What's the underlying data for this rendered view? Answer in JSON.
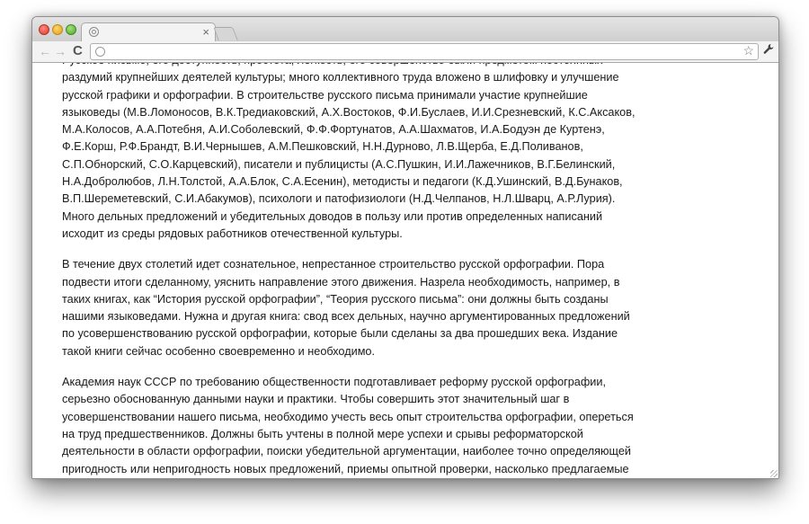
{
  "tab": {
    "title": "",
    "close_glyph": "×"
  },
  "toolbar": {
    "back_glyph": "←",
    "forward_glyph": "→",
    "reload_glyph": "C",
    "address_value": "",
    "bookmark_glyph": "☆",
    "menu_glyph": "🔧"
  },
  "page": {
    "paragraphs": [
      "Русское письмо, его доступность, простота, легкость, его совершенство были предметом постоянных\nраздумий крупнейших деятелей культуры; много коллективного труда вложено в шлифовку и улучшение\nрусской графики и орфографии. В строительстве русского письма принимали участие крупнейшие\nязыковеды (М.В.Ломоносов, В.К.Тредиаковский, А.Х.Востоков, Ф.И.Буслаев, И.И.Срезневский, К.С.Аксаков,\nМ.А.Колосов, А.А.Потебня, А.И.Соболевский, Ф.Ф.Фортунатов, А.А.Шахматов, И.А.Бодуэн де Куртенэ,\nФ.Е.Корш, Р.Ф.Брандт, В.И.Чернышев, А.М.Пешковский, Н.Н.Дурново, Л.В.Щерба, Е.Д.Поливанов,\nС.П.Обнорский, С.О.Карцевский), писатели и публицисты (А.С.Пушкин, И.И.Лажечников, В.Г.Белинский,\nН.А.Добролюбов, Л.Н.Толстой, А.А.Блок, С.А.Есенин), методисты и педагоги (К.Д.Ушинский, В.Д.Бунаков,\nВ.П.Шереметевский, С.И.Абакумов), психологи и патофизиологи (Н.Д.Челпанов, Н.Л.Шварц, А.Р.Лурия).\nМного дельных предложений и убедительных доводов в пользу или против определенных написаний\nисходит из среды рядовых работников отечественной культуры.",
      "В течение двух столетий идет сознательное, непрестанное строительство русской орфографии. Пора\nподвести итоги сделанному, уяснить направление этого движения. Назрела необходимость, например, в\nтаких книгах, как “История русской орфографии”, “Теория русского письма”: они должны быть созданы\nнашими языковедами. Нужна и другая книга: свод всех дельных, научно аргументированных предложений\nпо усовершенствованию русской орфографии, которые были сделаны за два прошедших века. Издание\nтакой книги сейчас особенно своевременно и необходимо.",
      "Академия наук СССР по требованию общественности подготавливает реформу русской орфографии,\nсерьезно обоснованную данными науки и практики. Чтобы совершить этот значительный шаг в\nусовершенствовании нашего письма, необходимо учесть весь опыт строительства орфографии, опереться\nна труд предшественников. Должны быть учтены в полной мере успехи и срывы реформаторской\nдеятельности в области орфографии, поиски убедительной аргументации, наиболее точно определяющей\nпригодность или непригодность новых предложений, приемы опытной проверки, насколько предлагаемые"
    ]
  }
}
